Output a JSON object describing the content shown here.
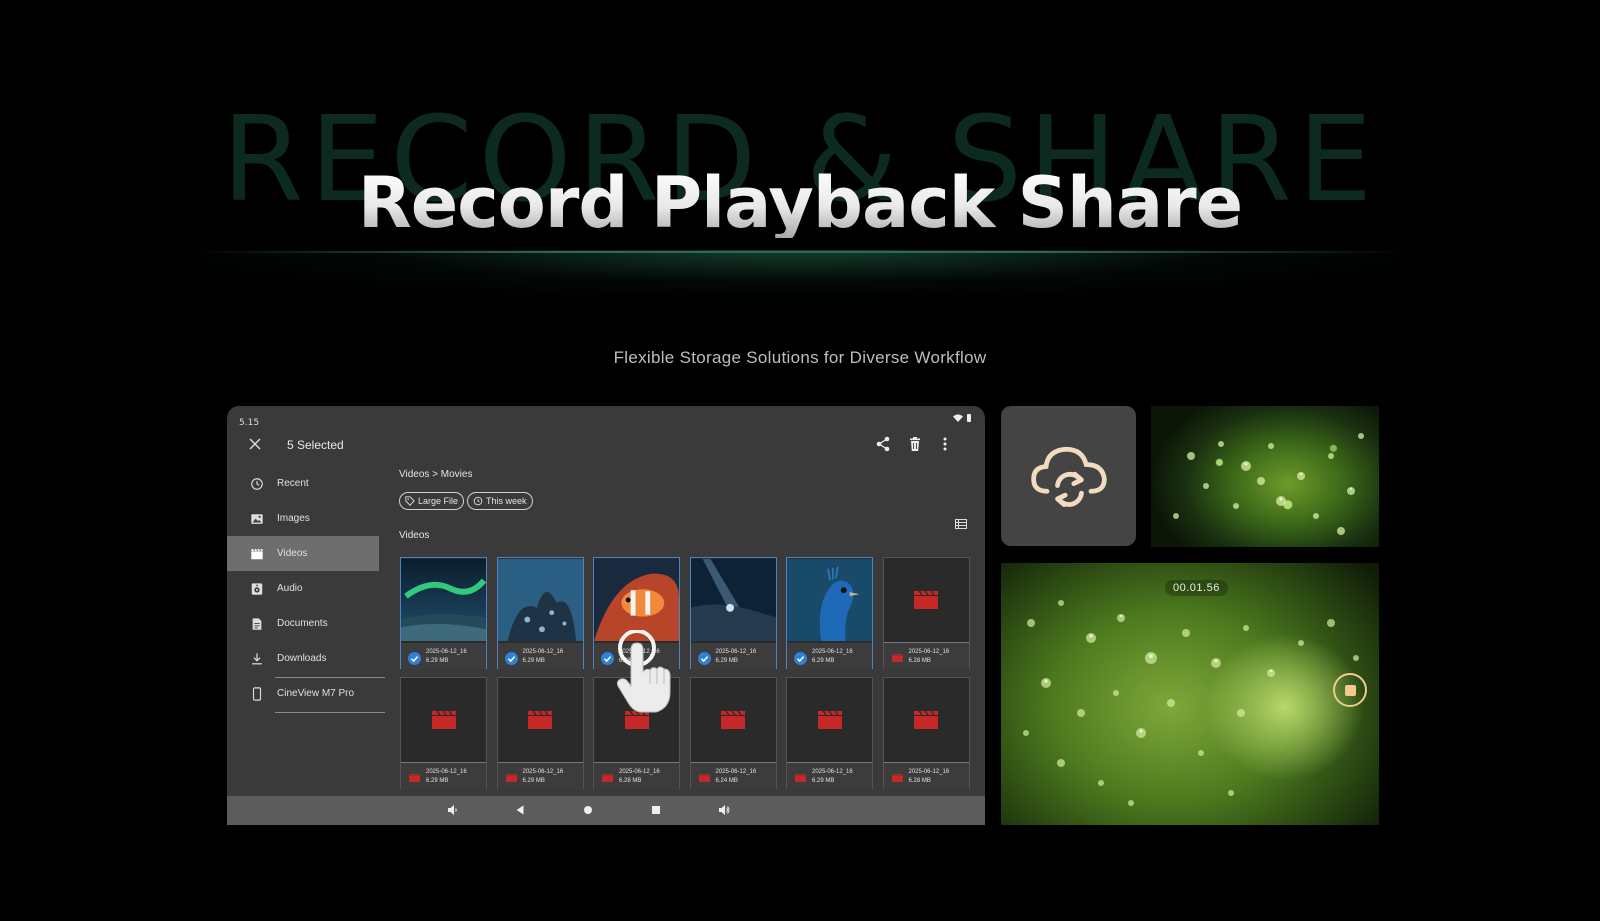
{
  "hero": {
    "background_word": "RECORD & SHARE",
    "title": "Record Playback Share",
    "subtitle": "Flexible Storage Solutions for Diverse Workflow"
  },
  "tablet": {
    "status_time": "5.15",
    "selection_title": "5 Selected",
    "breadcrumb": "Videos > Movies",
    "chips": [
      {
        "label": "Large File",
        "icon": "tag-icon"
      },
      {
        "label": "This week",
        "icon": "clock-icon"
      }
    ],
    "section_label": "Videos",
    "sidebar": [
      {
        "label": "Recent",
        "icon": "clock-icon"
      },
      {
        "label": "Images",
        "icon": "image-icon"
      },
      {
        "label": "Videos",
        "icon": "clapperboard-icon",
        "active": true
      },
      {
        "label": "Audio",
        "icon": "audio-icon"
      },
      {
        "label": "Documents",
        "icon": "document-icon"
      },
      {
        "label": "Downloads",
        "icon": "download-icon"
      },
      {
        "label": "CineView M7 Pro",
        "icon": "phone-icon"
      }
    ],
    "files": [
      {
        "date": "2025-06-12_16",
        "size": "6.29 MB",
        "selected": true,
        "thumb": "aurora"
      },
      {
        "date": "2025-06-12_16",
        "size": "6.29 MB",
        "selected": true,
        "thumb": "coral"
      },
      {
        "date": "2025-06-12_16",
        "size": "6.28 MB",
        "selected": true,
        "thumb": "clownfish"
      },
      {
        "date": "2025-06-12_16",
        "size": "6.29 MB",
        "selected": true,
        "thumb": "cave"
      },
      {
        "date": "2025-06-12_16",
        "size": "6.29 MB",
        "selected": true,
        "thumb": "peacock"
      },
      {
        "date": "2025-06-12_16",
        "size": "6.28 MB",
        "selected": false,
        "thumb": "video"
      },
      {
        "date": "2025-06-12_16",
        "size": "6.29 MB",
        "selected": false,
        "thumb": "video"
      },
      {
        "date": "2025-06-12_16",
        "size": "6.29 MB",
        "selected": false,
        "thumb": "video"
      },
      {
        "date": "2025-06-12_16",
        "size": "6.28 MB",
        "selected": false,
        "thumb": "video"
      },
      {
        "date": "2025-06-12_16",
        "size": "6.24 MB",
        "selected": false,
        "thumb": "video"
      },
      {
        "date": "2025-06-12_16",
        "size": "6.29 MB",
        "selected": false,
        "thumb": "video"
      },
      {
        "date": "2025-06-12_16",
        "size": "6.28 MB",
        "selected": false,
        "thumb": "video"
      }
    ]
  },
  "preview": {
    "timer": "00.01.56"
  },
  "colors": {
    "accent_check": "#2f80d6",
    "video_red": "#c62828",
    "record_button": "#f2c98e"
  }
}
